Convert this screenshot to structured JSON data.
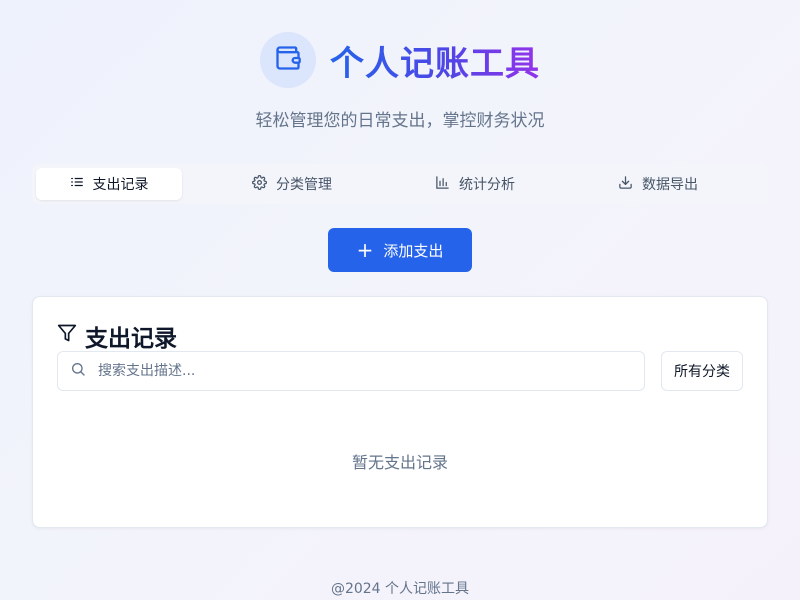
{
  "header": {
    "title": "个人记账工具",
    "subtitle": "轻松管理您的日常支出，掌控财务状况",
    "logo_icon": "wallet-icon"
  },
  "tabs": [
    {
      "label": "支出记录",
      "icon": "list-icon",
      "active": true
    },
    {
      "label": "分类管理",
      "icon": "gear-icon",
      "active": false
    },
    {
      "label": "统计分析",
      "icon": "bar-chart-icon",
      "active": false
    },
    {
      "label": "数据导出",
      "icon": "download-icon",
      "active": false
    }
  ],
  "actions": {
    "add_expense_label": "添加支出"
  },
  "records_panel": {
    "title": "支出记录",
    "title_icon": "filter-icon",
    "search_placeholder": "搜索支出描述...",
    "search_value": "",
    "category_filter_value": "所有分类",
    "empty_message": "暂无支出记录"
  },
  "footer": {
    "copyright": "@2024 个人记账工具"
  },
  "colors": {
    "primary": "#2563eb",
    "title_gradient_start": "#2563eb",
    "title_gradient_end": "#9333ea",
    "muted_text": "#64748b",
    "border": "#e2e8f0"
  }
}
